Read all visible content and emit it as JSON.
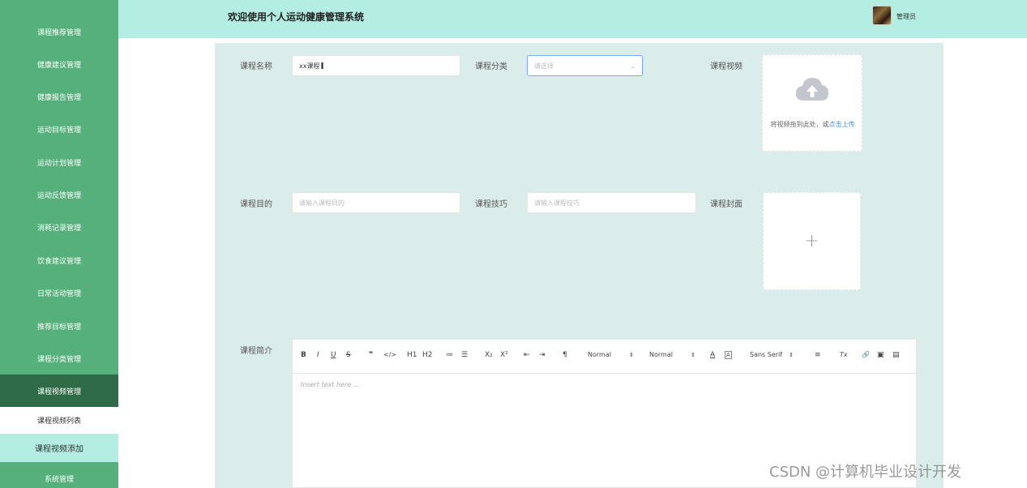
{
  "sidebar": {
    "items": [
      {
        "label": "课程推荐管理"
      },
      {
        "label": "健康建议管理"
      },
      {
        "label": "健康报告管理"
      },
      {
        "label": "运动目标管理"
      },
      {
        "label": "运动计划管理"
      },
      {
        "label": "运动反馈管理"
      },
      {
        "label": "消耗记录管理"
      },
      {
        "label": "饮食建议管理"
      },
      {
        "label": "日常活动管理"
      },
      {
        "label": "推荐目标管理"
      },
      {
        "label": "课程分类管理"
      }
    ],
    "active_item": {
      "label": "课程视频管理"
    },
    "sub_items": [
      {
        "label": "课程视频列表"
      },
      {
        "label": "课程视频添加"
      }
    ],
    "bottom_item": {
      "label": "系统管理"
    }
  },
  "header": {
    "title": "欢迎使用个人运动健康管理系统",
    "user_name": "管理员"
  },
  "form": {
    "course_name_label": "课程名称",
    "course_name_value": "xx课程",
    "category_label": "课程分类",
    "category_placeholder": "请选择",
    "video_label": "课程视频",
    "video_upload_text": "将视频拖到此处，或",
    "video_upload_link": "点击上传",
    "purpose_label": "课程目的",
    "purpose_placeholder": "请输入课程目的",
    "technique_label": "课程技巧",
    "technique_placeholder": "请输入课程技巧",
    "cover_label": "课程封面",
    "cover_plus": "+",
    "intro_label": "课程简介"
  },
  "editor": {
    "toolbar": {
      "bold": "B",
      "italic": "I",
      "underline": "U",
      "strike": "S",
      "quote": "❞",
      "code": "</>",
      "h1": "H1",
      "h2": "H2",
      "ordered_list": "≔",
      "bullet_list": "☰",
      "subscript": "X₂",
      "superscript": "X²",
      "outdent": "⇤",
      "indent": "⇥",
      "direction": "¶",
      "size_select": "Normal",
      "header_select": "Normal",
      "color": "A",
      "background": "A",
      "font_select": "Sans Serif",
      "align": "≡",
      "clean": "Tx",
      "link": "🔗",
      "image": "▣",
      "video": "▤"
    },
    "placeholder": "Insert text here ..."
  },
  "watermark": "CSDN @计算机毕业设计开发"
}
